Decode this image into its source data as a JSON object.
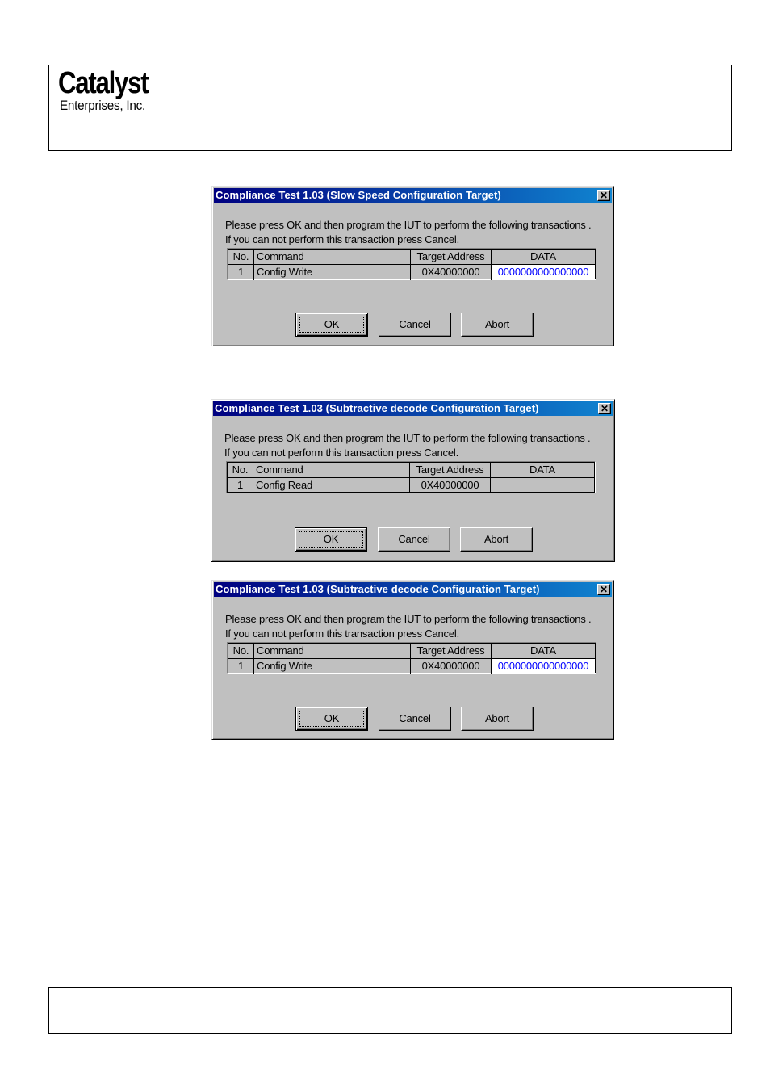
{
  "header": {
    "logo_main": "Catalyst",
    "logo_sub": "Enterprises, Inc."
  },
  "dialogs": [
    {
      "title": "Compliance Test 1.03 (Slow Speed Configuration Target)",
      "close_icon": "close-icon",
      "close_glyph": "✕",
      "message_line1": "Please press OK and then program the IUT to perform the following transactions .",
      "message_line2": "If you can not perform this transaction press Cancel.",
      "table": {
        "columns": [
          "No.",
          "Command",
          "Target Address",
          "DATA"
        ],
        "rows": [
          {
            "no": "1",
            "command": "Config Write",
            "target_address": "0X40000000",
            "data": "0000000000000000"
          }
        ]
      },
      "buttons": {
        "ok": "OK",
        "cancel": "Cancel",
        "abort": "Abort"
      }
    },
    {
      "title": "Compliance Test 1.03 (Subtractive decode Configuration Target)",
      "close_icon": "close-icon",
      "close_glyph": "✕",
      "message_line1": "Please press OK and then program the IUT to perform the following transactions .",
      "message_line2": "If you can not perform this transaction press Cancel.",
      "table": {
        "columns": [
          "No.",
          "Command",
          "Target Address",
          "DATA"
        ],
        "rows": [
          {
            "no": "1",
            "command": "Config Read",
            "target_address": "0X40000000",
            "data": ""
          }
        ]
      },
      "buttons": {
        "ok": "OK",
        "cancel": "Cancel",
        "abort": "Abort"
      }
    },
    {
      "title": "Compliance Test 1.03 (Subtractive decode Configuration Target)",
      "close_icon": "close-icon",
      "close_glyph": "✕",
      "message_line1": "Please press OK and then program the IUT to perform the following transactions .",
      "message_line2": "If you can not perform this transaction press Cancel.",
      "table": {
        "columns": [
          "No.",
          "Command",
          "Target Address",
          "DATA"
        ],
        "rows": [
          {
            "no": "1",
            "command": "Config Write",
            "target_address": "0X40000000",
            "data": "0000000000000000"
          }
        ]
      },
      "buttons": {
        "ok": "OK",
        "cancel": "Cancel",
        "abort": "Abort"
      }
    }
  ],
  "colors": {
    "titlebar_start": "#000080",
    "titlebar_end": "#1084d0",
    "dialog_face": "#c0c0c0",
    "data_value": "#0000ff"
  },
  "footer": {}
}
